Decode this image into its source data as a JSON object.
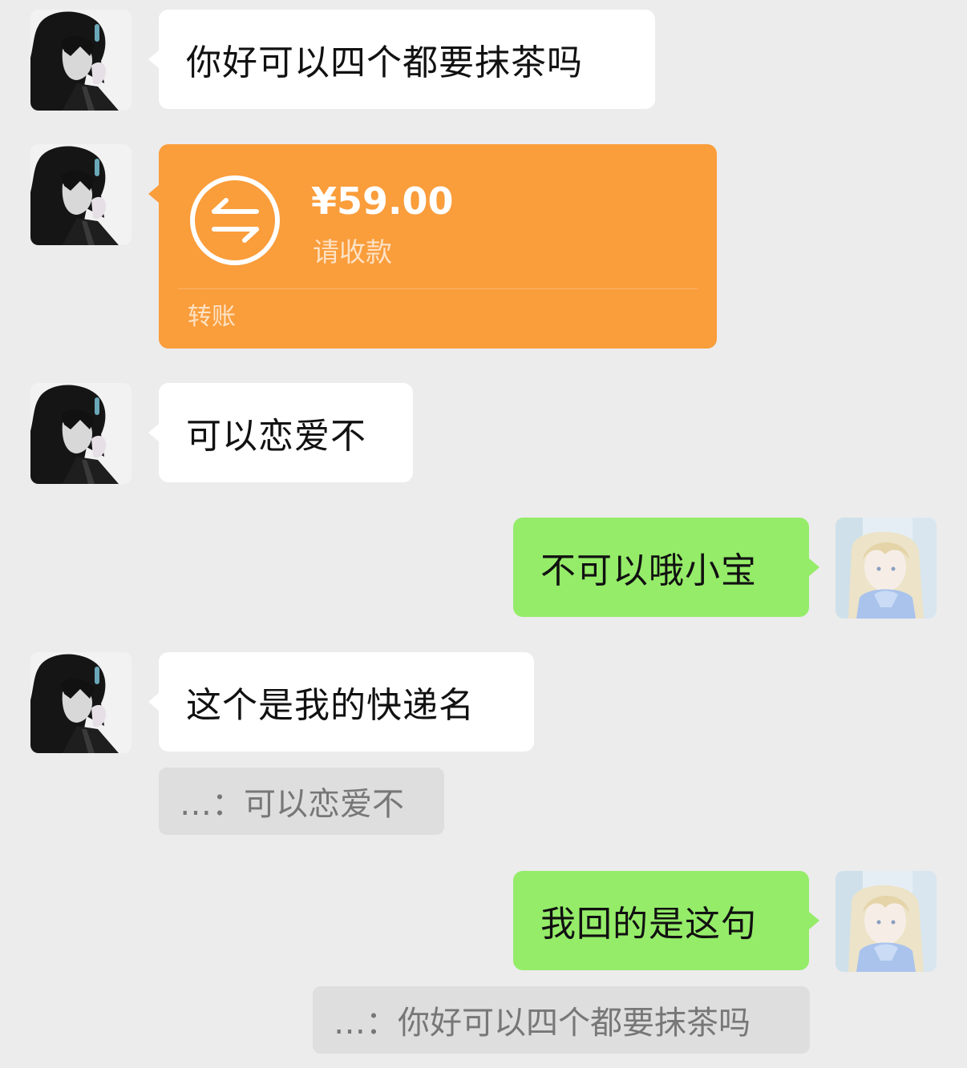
{
  "messages": [
    {
      "sender": "other",
      "type": "text",
      "text": "你好可以四个都要抹茶吗"
    },
    {
      "sender": "other",
      "type": "transfer",
      "amount": "¥59.00",
      "status": "请收款",
      "caption": "转账"
    },
    {
      "sender": "other",
      "type": "text",
      "text": "可以恋爱不"
    },
    {
      "sender": "self",
      "type": "text",
      "text": "不可以哦小宝"
    },
    {
      "sender": "other",
      "type": "text",
      "text": "这个是我的快递名",
      "quote": "…：可以恋爱不"
    },
    {
      "sender": "self",
      "type": "text",
      "text": "我回的是这句",
      "quote": "…：你好可以四个都要抹茶吗"
    }
  ],
  "colors": {
    "background": "#ececec",
    "incoming_bubble": "#ffffff",
    "outgoing_bubble": "#95ec69",
    "transfer_card": "#fa9d3b",
    "quote_box": "#dedede"
  },
  "icons": {
    "transfer": "transfer-arrows-icon",
    "other_avatar": "dark-hair-anime-boy-avatar",
    "self_avatar": "blonde-anime-girl-avatar"
  }
}
